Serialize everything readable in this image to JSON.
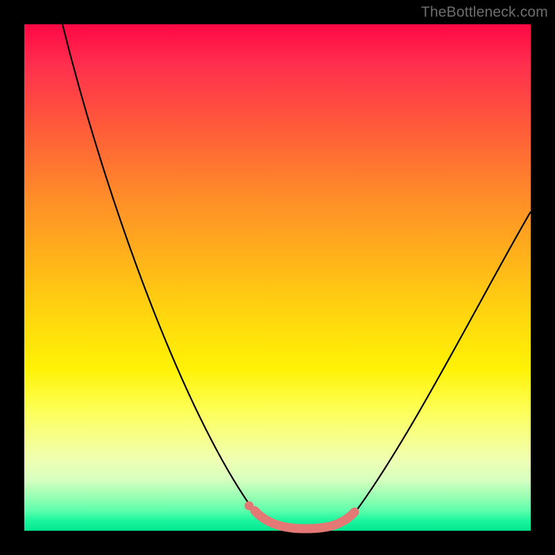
{
  "watermark": "TheBottleneck.com",
  "colors": {
    "frame": "#000000",
    "curve": "#000000",
    "marker": "#e37874",
    "gradient_top": "#ff0844",
    "gradient_bottom": "#00e68f"
  },
  "chart_data": {
    "type": "line",
    "title": "",
    "xlabel": "",
    "ylabel": "",
    "xlim": [
      0,
      100
    ],
    "ylim": [
      0,
      100
    ],
    "grid": false,
    "legend": false,
    "series": [
      {
        "name": "bottleneck-curve",
        "x": [
          8,
          15,
          25,
          35,
          45,
          50,
          55,
          60,
          65,
          75,
          85,
          100
        ],
        "y": [
          100,
          78,
          52,
          30,
          6,
          1,
          0,
          1,
          4,
          24,
          46,
          63
        ]
      }
    ],
    "annotations": [
      {
        "name": "optimal-range",
        "x_start": 45,
        "x_end": 65,
        "y": 0,
        "color": "#e37874"
      },
      {
        "name": "optimal-start-dot",
        "x": 44,
        "y": 5,
        "color": "#e37874"
      }
    ],
    "background": {
      "style": "vertical-gradient",
      "meaning": "green (good / low bottleneck) at bottom through yellow/orange to red (bad / high bottleneck) at top"
    }
  }
}
